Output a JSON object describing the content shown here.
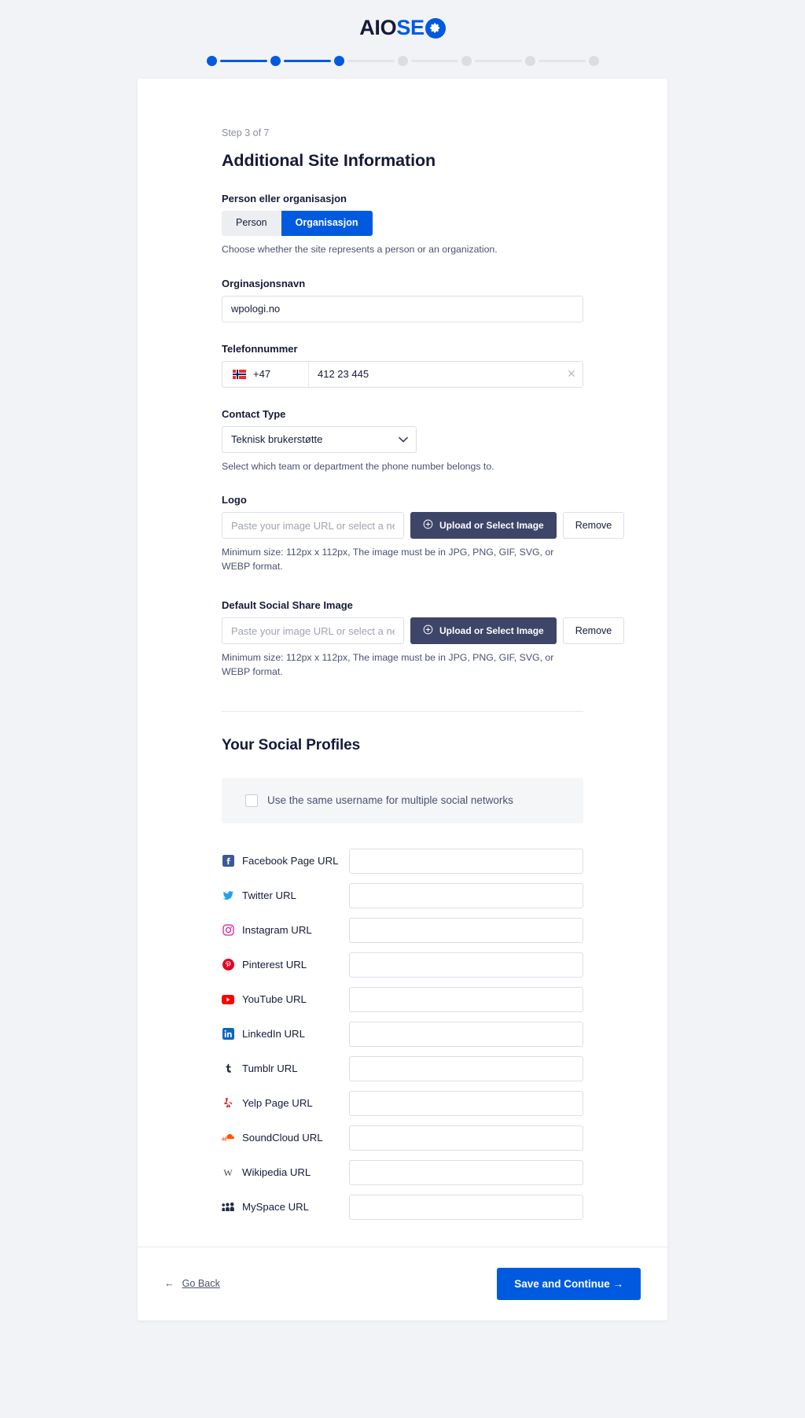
{
  "brand": {
    "logo_aio": "AIO",
    "logo_se": "SE",
    "logo_gear_icon": "gear-icon",
    "accent_color": "#005ae0",
    "dark_color": "#141b38"
  },
  "stepper": {
    "total": 7,
    "current": 3,
    "steps": [
      {
        "state": "done"
      },
      {
        "state": "done"
      },
      {
        "state": "done"
      },
      {
        "state": "todo"
      },
      {
        "state": "todo"
      },
      {
        "state": "todo"
      },
      {
        "state": "todo"
      }
    ]
  },
  "main": {
    "step_label": "Step 3 of 7",
    "title": "Additional Site Information",
    "person_or_org": {
      "label": "Person eller organisasjon",
      "option_person": "Person",
      "option_organisation": "Organisasjon",
      "selected": "Organisasjon",
      "help": "Choose whether the site represents a person or an organization."
    },
    "org_name": {
      "label": "Orginasjonsnavn",
      "value": "wpologi.no"
    },
    "phone": {
      "label": "Telefonnummer",
      "country_flag": "flag-norway-icon",
      "country_code": "+47",
      "value": "412 23 445",
      "clear_icon": "close-icon"
    },
    "contact_type": {
      "label": "Contact Type",
      "value": "Teknisk brukerstøtte",
      "help": "Select which team or department the phone number belongs to.",
      "chevron_icon": "chevron-down-icon"
    },
    "logo_field": {
      "label": "Logo",
      "placeholder": "Paste your image URL or select a new image",
      "value": "",
      "upload_label": "Upload or Select Image",
      "upload_icon": "plus-circle-icon",
      "remove_label": "Remove",
      "help": "Minimum size: 112px x 112px, The image must be in JPG, PNG, GIF, SVG, or WEBP format."
    },
    "social_share_image": {
      "label": "Default Social Share Image",
      "placeholder": "Paste your image URL or select a new image",
      "value": "",
      "upload_label": "Upload or Select Image",
      "upload_icon": "plus-circle-icon",
      "remove_label": "Remove",
      "help": "Minimum size: 112px x 112px, The image must be in JPG, PNG, GIF, SVG, or WEBP format."
    }
  },
  "social": {
    "title": "Your Social Profiles",
    "same_username_label": "Use the same username for multiple social networks",
    "same_username_checked": false,
    "profiles": [
      {
        "icon": "facebook-icon",
        "label": "Facebook Page URL",
        "value": ""
      },
      {
        "icon": "twitter-icon",
        "label": "Twitter URL",
        "value": ""
      },
      {
        "icon": "instagram-icon",
        "label": "Instagram URL",
        "value": ""
      },
      {
        "icon": "pinterest-icon",
        "label": "Pinterest URL",
        "value": ""
      },
      {
        "icon": "youtube-icon",
        "label": "YouTube URL",
        "value": ""
      },
      {
        "icon": "linkedin-icon",
        "label": "LinkedIn URL",
        "value": ""
      },
      {
        "icon": "tumblr-icon",
        "label": "Tumblr URL",
        "value": ""
      },
      {
        "icon": "yelp-icon",
        "label": "Yelp Page URL",
        "value": ""
      },
      {
        "icon": "soundcloud-icon",
        "label": "SoundCloud URL",
        "value": ""
      },
      {
        "icon": "wikipedia-icon",
        "label": "Wikipedia URL",
        "value": ""
      },
      {
        "icon": "myspace-icon",
        "label": "MySpace URL",
        "value": ""
      }
    ]
  },
  "footer": {
    "back_arrow": "←",
    "back_label": "Go Back",
    "continue_label": "Save and Continue  →"
  }
}
